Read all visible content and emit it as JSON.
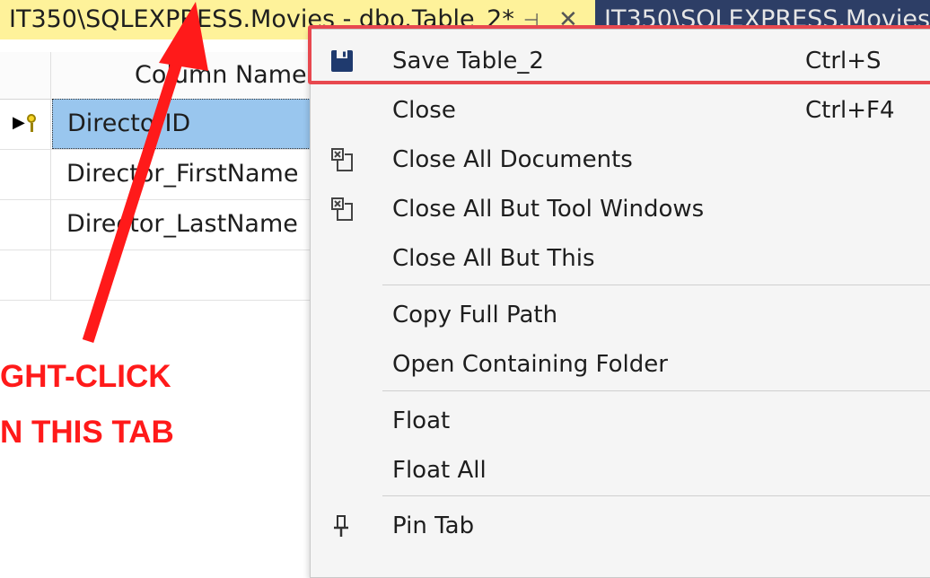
{
  "tabs": {
    "active_title": "IT350\\SQLEXPRESS.Movies - dbo.Table_2*",
    "pin_glyph": "⊣",
    "close_glyph": "✕",
    "inactive_title": "IT350\\SQLEXPRESS.Movies"
  },
  "grid": {
    "column_header": "Column Name",
    "rows": [
      "DirectorID",
      "Director_FirstName",
      "Director_LastName",
      ""
    ]
  },
  "annotation": {
    "line1": "GHT-CLICK",
    "line2": "N THIS TAB",
    "color": "#ff1a1a"
  },
  "context_menu": {
    "items": [
      {
        "label": "Save Table_2",
        "shortcut": "Ctrl+S",
        "icon": "save-icon"
      },
      {
        "label": "Close",
        "shortcut": "Ctrl+F4",
        "icon": ""
      },
      {
        "label": "Close All Documents",
        "shortcut": "",
        "icon": "close-all-documents-icon"
      },
      {
        "label": "Close All But Tool Windows",
        "shortcut": "",
        "icon": "close-all-but-tool-windows-icon"
      },
      {
        "label": "Close All But This",
        "shortcut": "",
        "icon": ""
      },
      {
        "label": "Copy Full Path",
        "shortcut": "",
        "icon": ""
      },
      {
        "label": "Open Containing Folder",
        "shortcut": "",
        "icon": ""
      },
      {
        "label": "Float",
        "shortcut": "",
        "icon": ""
      },
      {
        "label": "Float All",
        "shortcut": "",
        "icon": ""
      },
      {
        "label": "Pin Tab",
        "shortcut": "",
        "icon": "pin-icon"
      }
    ]
  },
  "colors": {
    "active_tab": "#fef29a",
    "inactive_tab": "#2d3e66",
    "selected_row": "#99c6ee",
    "highlight_box": "#e8484f",
    "arrow": "#ff1a1a",
    "save_icon": "#1f3a6e"
  }
}
